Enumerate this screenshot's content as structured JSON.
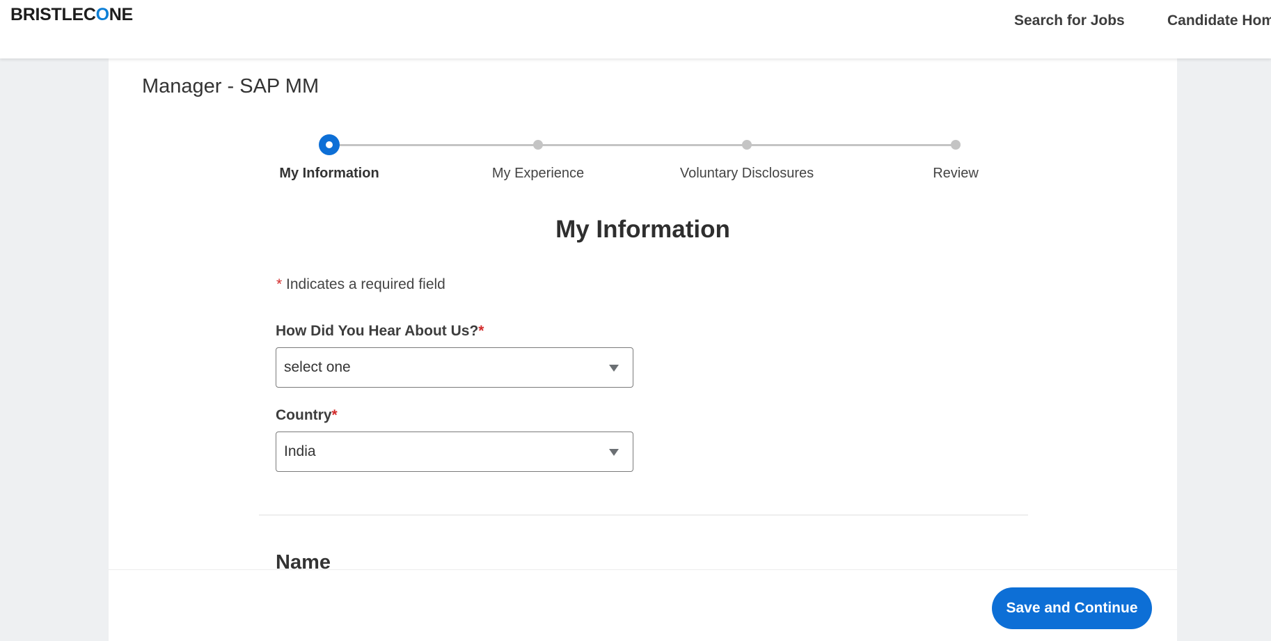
{
  "header": {
    "logo_text_prefix": "BRISTLEC",
    "logo_text_o": "O",
    "logo_text_suffix": "NE",
    "nav": [
      "Search for Jobs",
      "Candidate Home"
    ]
  },
  "job_title": "Manager - SAP MM",
  "stepper": {
    "steps": [
      "My Information",
      "My Experience",
      "Voluntary Disclosures",
      "Review"
    ],
    "active_index": 0
  },
  "form": {
    "section_title": "My Information",
    "required_star": "*",
    "required_note": "Indicates a required field",
    "fields": [
      {
        "label": "How Did You Hear About Us?",
        "required": true,
        "value": "select one"
      },
      {
        "label": "Country",
        "required": true,
        "value": "India"
      }
    ],
    "next_section_heading": "Name"
  },
  "footer": {
    "save_label": "Save and Continue"
  },
  "colors": {
    "accent": "#0d6fd6",
    "required": "#d22a2a",
    "background": "#eef0f2"
  }
}
